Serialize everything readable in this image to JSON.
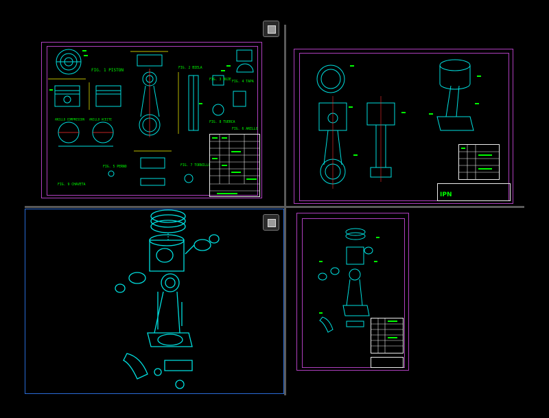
{
  "viewports": {
    "top_left": {
      "name": "drawing-sheet-parts"
    },
    "top_right": {
      "name": "drawing-sheet-assembly"
    },
    "bottom_left": {
      "name": "model-exploded-3d"
    },
    "bottom_right": {
      "name": "drawing-sheet-exploded"
    }
  },
  "title_block": {
    "logo_text": "IPN"
  },
  "view_labels": {
    "a": "FIG. 1 PISTON",
    "b": "FIG. 2 BIELA",
    "c": "FIG. 3 BUJE",
    "d": "FIG. 4 TAPA",
    "e": "FIG. 5 PERNO",
    "f": "FIG. 6 ANILLO",
    "g": "FIG. 7 TORNILLO",
    "h": "FIG. 8 TUERCA",
    "i": "FIG. 9 CHAVETA",
    "j": "ANILLO COMPRESION",
    "k": "ANILLO ACEITE"
  },
  "colors": {
    "background": "#000000",
    "sheet_border": "#b040c0",
    "geometry": "#00e0e0",
    "dims": "#ffff00",
    "annotation": "#00ff00",
    "viewport_border": "#2a6cd8",
    "divider": "#5a5a5a"
  },
  "icons": [
    "view-cube-icon",
    "view-cube-icon-2"
  ]
}
